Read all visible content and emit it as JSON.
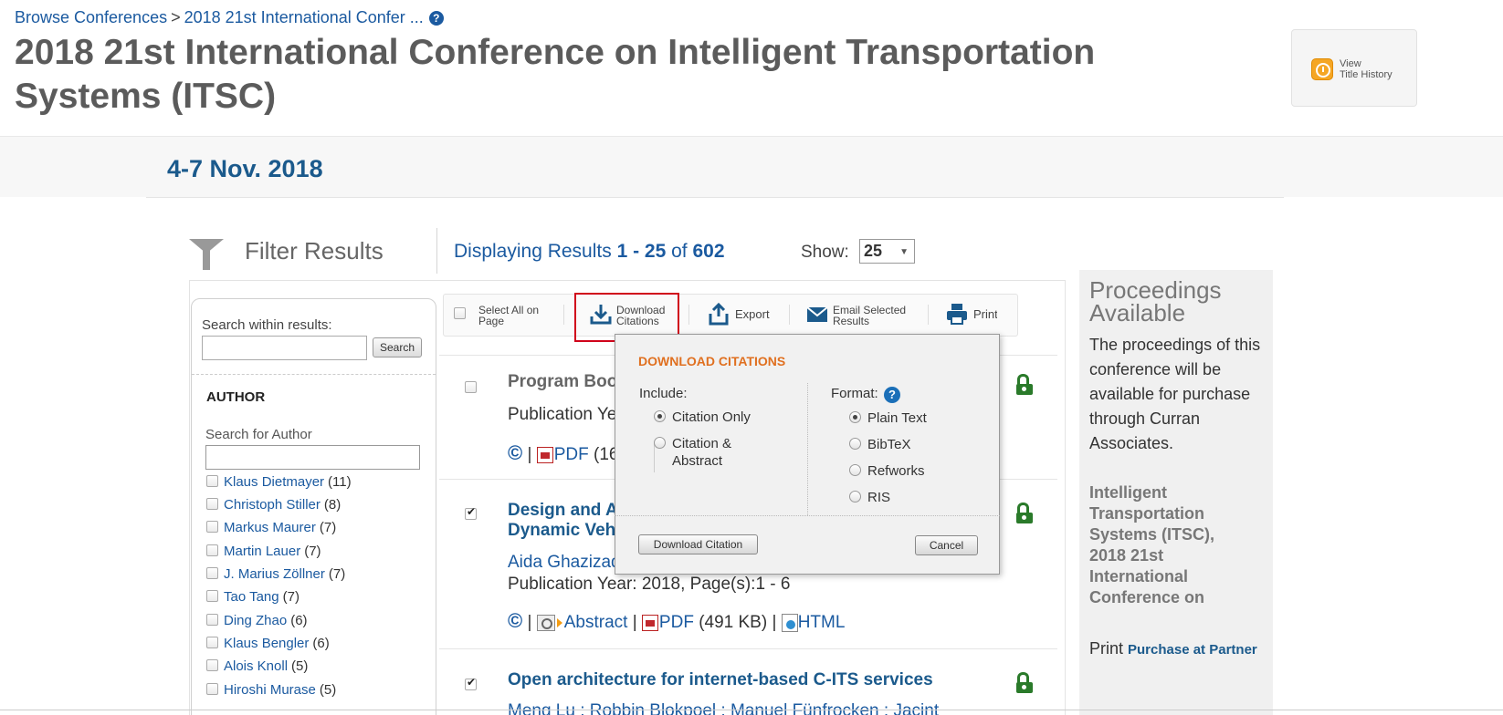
{
  "breadcrumb": {
    "root": "Browse Conferences",
    "separator": ">",
    "current": "2018 21st International Confer ...",
    "help": "?"
  },
  "page_title": "2018 21st International Conference on Intelligent Transportation Systems (ITSC)",
  "title_history": {
    "line1": "View",
    "line2": "Title History"
  },
  "conference_date": "4-7 Nov. 2018",
  "filter": {
    "title": "Filter Results",
    "search_label": "Search within results:",
    "search_value": "",
    "search_button": "Search",
    "author_heading": "AUTHOR",
    "author_search_label": "Search for Author",
    "author_search_value": "",
    "authors": [
      {
        "name": "Klaus Dietmayer",
        "count": "(11)"
      },
      {
        "name": "Christoph Stiller",
        "count": "(8)"
      },
      {
        "name": "Markus Maurer",
        "count": "(7)"
      },
      {
        "name": "Martin Lauer",
        "count": "(7)"
      },
      {
        "name": "J. Marius Zöllner",
        "count": "(7)"
      },
      {
        "name": "Tao Tang",
        "count": "(7)"
      },
      {
        "name": "Ding Zhao",
        "count": "(6)"
      },
      {
        "name": "Klaus Bengler",
        "count": "(6)"
      },
      {
        "name": "Alois Knoll",
        "count": "(5)"
      },
      {
        "name": "Hiroshi Murase",
        "count": "(5)"
      }
    ]
  },
  "results_header": {
    "prefix": "Displaying Results ",
    "range": "1 - 25",
    "of": " of ",
    "total": "602",
    "show_label": "Show:",
    "show_value": "25"
  },
  "toolbar": {
    "select_all_line1": "Select All on",
    "select_all_line2": "Page",
    "download_line1": "Download",
    "download_line2": "Citations",
    "export": "Export",
    "email_line1": "Email Selected",
    "email_line2": "Results",
    "print": "Print"
  },
  "results": [
    {
      "title": "Program Boo",
      "meta": "Publication Ye",
      "pdf": "PDF",
      "pdf_size": "(16",
      "checked": false
    },
    {
      "title_line1": "Design and A",
      "title_line2": "Dynamic Veh",
      "authors": "Aida Ghazizad",
      "meta": "Publication Year: 2018, Page(s):1 - 6",
      "abstract": "Abstract",
      "pdf": "PDF",
      "pdf_size": "(491 KB)",
      "html": "HTML",
      "checked": true
    },
    {
      "title": "Open architecture for internet-based C-ITS services",
      "authors": "Meng Lu ; Robbin Blokpoel ; Manuel Fünfrocken ; Jacint",
      "checked": true
    }
  ],
  "link_separator": "|",
  "proceedings": {
    "title": "Proceedings Available",
    "description": "The proceedings of this conference will be available for purchase through Curran Associates.",
    "series": "Intelligent Transportation Systems (ITSC), 2018 21st International Conference on",
    "print_label": "Print ",
    "purchase_link": "Purchase at Partner"
  },
  "download_popup": {
    "title": "DOWNLOAD CITATIONS",
    "include_label": "Include:",
    "include_options": [
      {
        "label": "Citation Only",
        "selected": true
      },
      {
        "label_line1": "Citation &",
        "label_line2": "Abstract",
        "selected": false
      }
    ],
    "format_label": "Format:",
    "help": "?",
    "format_options": [
      {
        "label": "Plain Text",
        "selected": true
      },
      {
        "label": "BibTeX",
        "selected": false
      },
      {
        "label": "Refworks",
        "selected": false
      },
      {
        "label": "RIS",
        "selected": false
      }
    ],
    "download_button": "Download Citation",
    "cancel_button": "Cancel"
  },
  "colors": {
    "link_blue": "#1b5aa0",
    "popup_title_orange": "#e07020",
    "highlight_red": "#d0021b",
    "lock_green": "#2a7a2a"
  }
}
